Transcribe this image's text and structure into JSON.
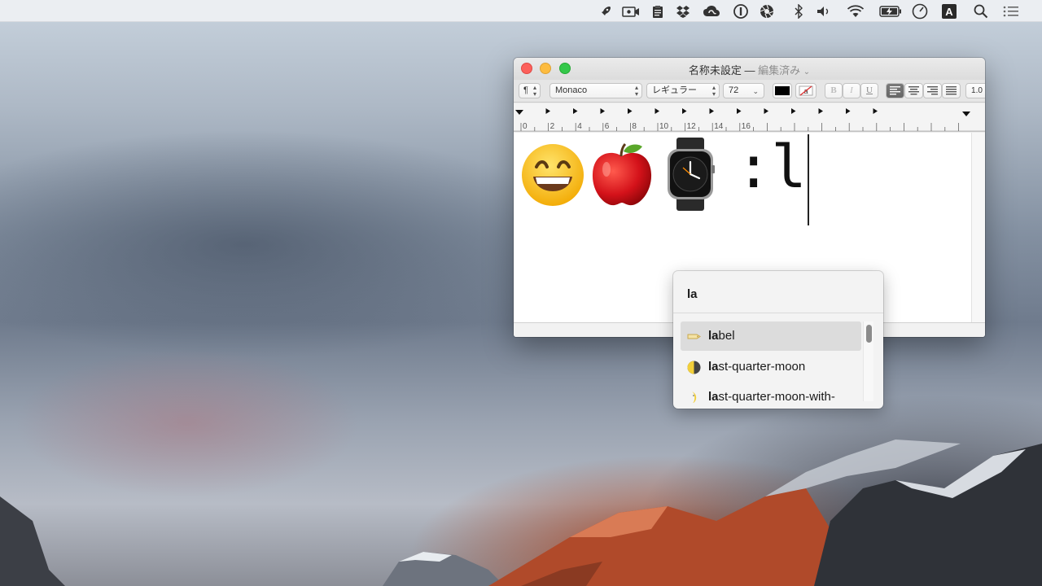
{
  "menubar": {
    "icons": [
      "rocket-icon",
      "screen-record-icon",
      "clipboard-icon",
      "dropbox-icon",
      "creative-cloud-icon",
      "onepassword-icon",
      "aperture-icon",
      "bluetooth-icon",
      "volume-icon",
      "wifi-icon",
      "battery-icon",
      "clock-icon",
      "input-source-icon",
      "spotlight-icon",
      "notification-center-icon"
    ],
    "input_source_label": "A"
  },
  "window": {
    "title": "名称未設定",
    "title_separator": "—",
    "edited_label": "編集済み",
    "toolbar": {
      "paragraph_symbol": "¶",
      "font_family": "Monaco",
      "font_style": "レギュラー",
      "font_size": "72",
      "bold_label": "B",
      "italic_label": "I",
      "underline_label": "U",
      "line_spacing": "1.0"
    },
    "ruler_labels": [
      "0",
      "2",
      "4",
      "6",
      "8",
      "10",
      "12",
      "14",
      "16"
    ],
    "document": {
      "emojis": [
        "grinning-face",
        "red-apple",
        "watch"
      ],
      "typed_text": ":l"
    }
  },
  "emoji_picker": {
    "query": "la",
    "items": [
      {
        "match": "la",
        "rest": "bel",
        "icon": "label-tag-icon"
      },
      {
        "match": "la",
        "rest": "st-quarter-moon",
        "icon": "last-quarter-moon-icon"
      },
      {
        "match": "la",
        "rest": "st-quarter-moon-with-",
        "icon": "last-quarter-moon-with-face-icon"
      }
    ]
  }
}
